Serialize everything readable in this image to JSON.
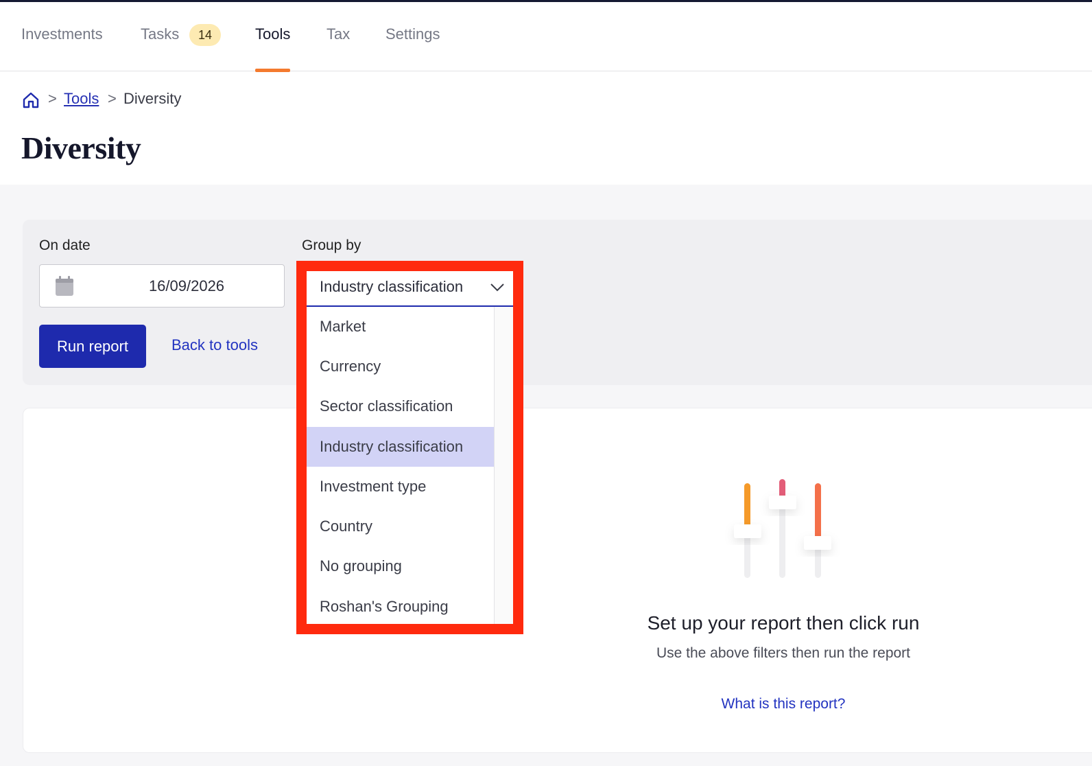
{
  "nav": {
    "items": [
      {
        "label": "Investments"
      },
      {
        "label": "Tasks",
        "badge": "14"
      },
      {
        "label": "Tools",
        "active": true
      },
      {
        "label": "Tax"
      },
      {
        "label": "Settings"
      }
    ]
  },
  "breadcrumb": {
    "home_icon": "home-icon",
    "link": "Tools",
    "current": "Diversity",
    "separator": ">"
  },
  "page": {
    "title": "Diversity"
  },
  "filters": {
    "date_label": "On date",
    "date_value": "16/09/2026",
    "group_label": "Group by",
    "group_value": "Industry classification",
    "run_label": "Run report",
    "back_label": "Back to tools",
    "options": [
      "Market",
      "Currency",
      "Sector classification",
      "Industry classification",
      "Investment type",
      "Country",
      "No grouping",
      "Roshan's Grouping"
    ],
    "selected_option": "Industry classification"
  },
  "empty_state": {
    "title": "Set up your report then click run",
    "subtitle": "Use the above filters then run the report",
    "link": "What is this report?"
  },
  "colors": {
    "primary": "#1e2aad",
    "accent": "#f47a2e",
    "highlight": "#ff2a0e",
    "selected_option": "#d2d3f6",
    "badge": "#fdeab2"
  }
}
